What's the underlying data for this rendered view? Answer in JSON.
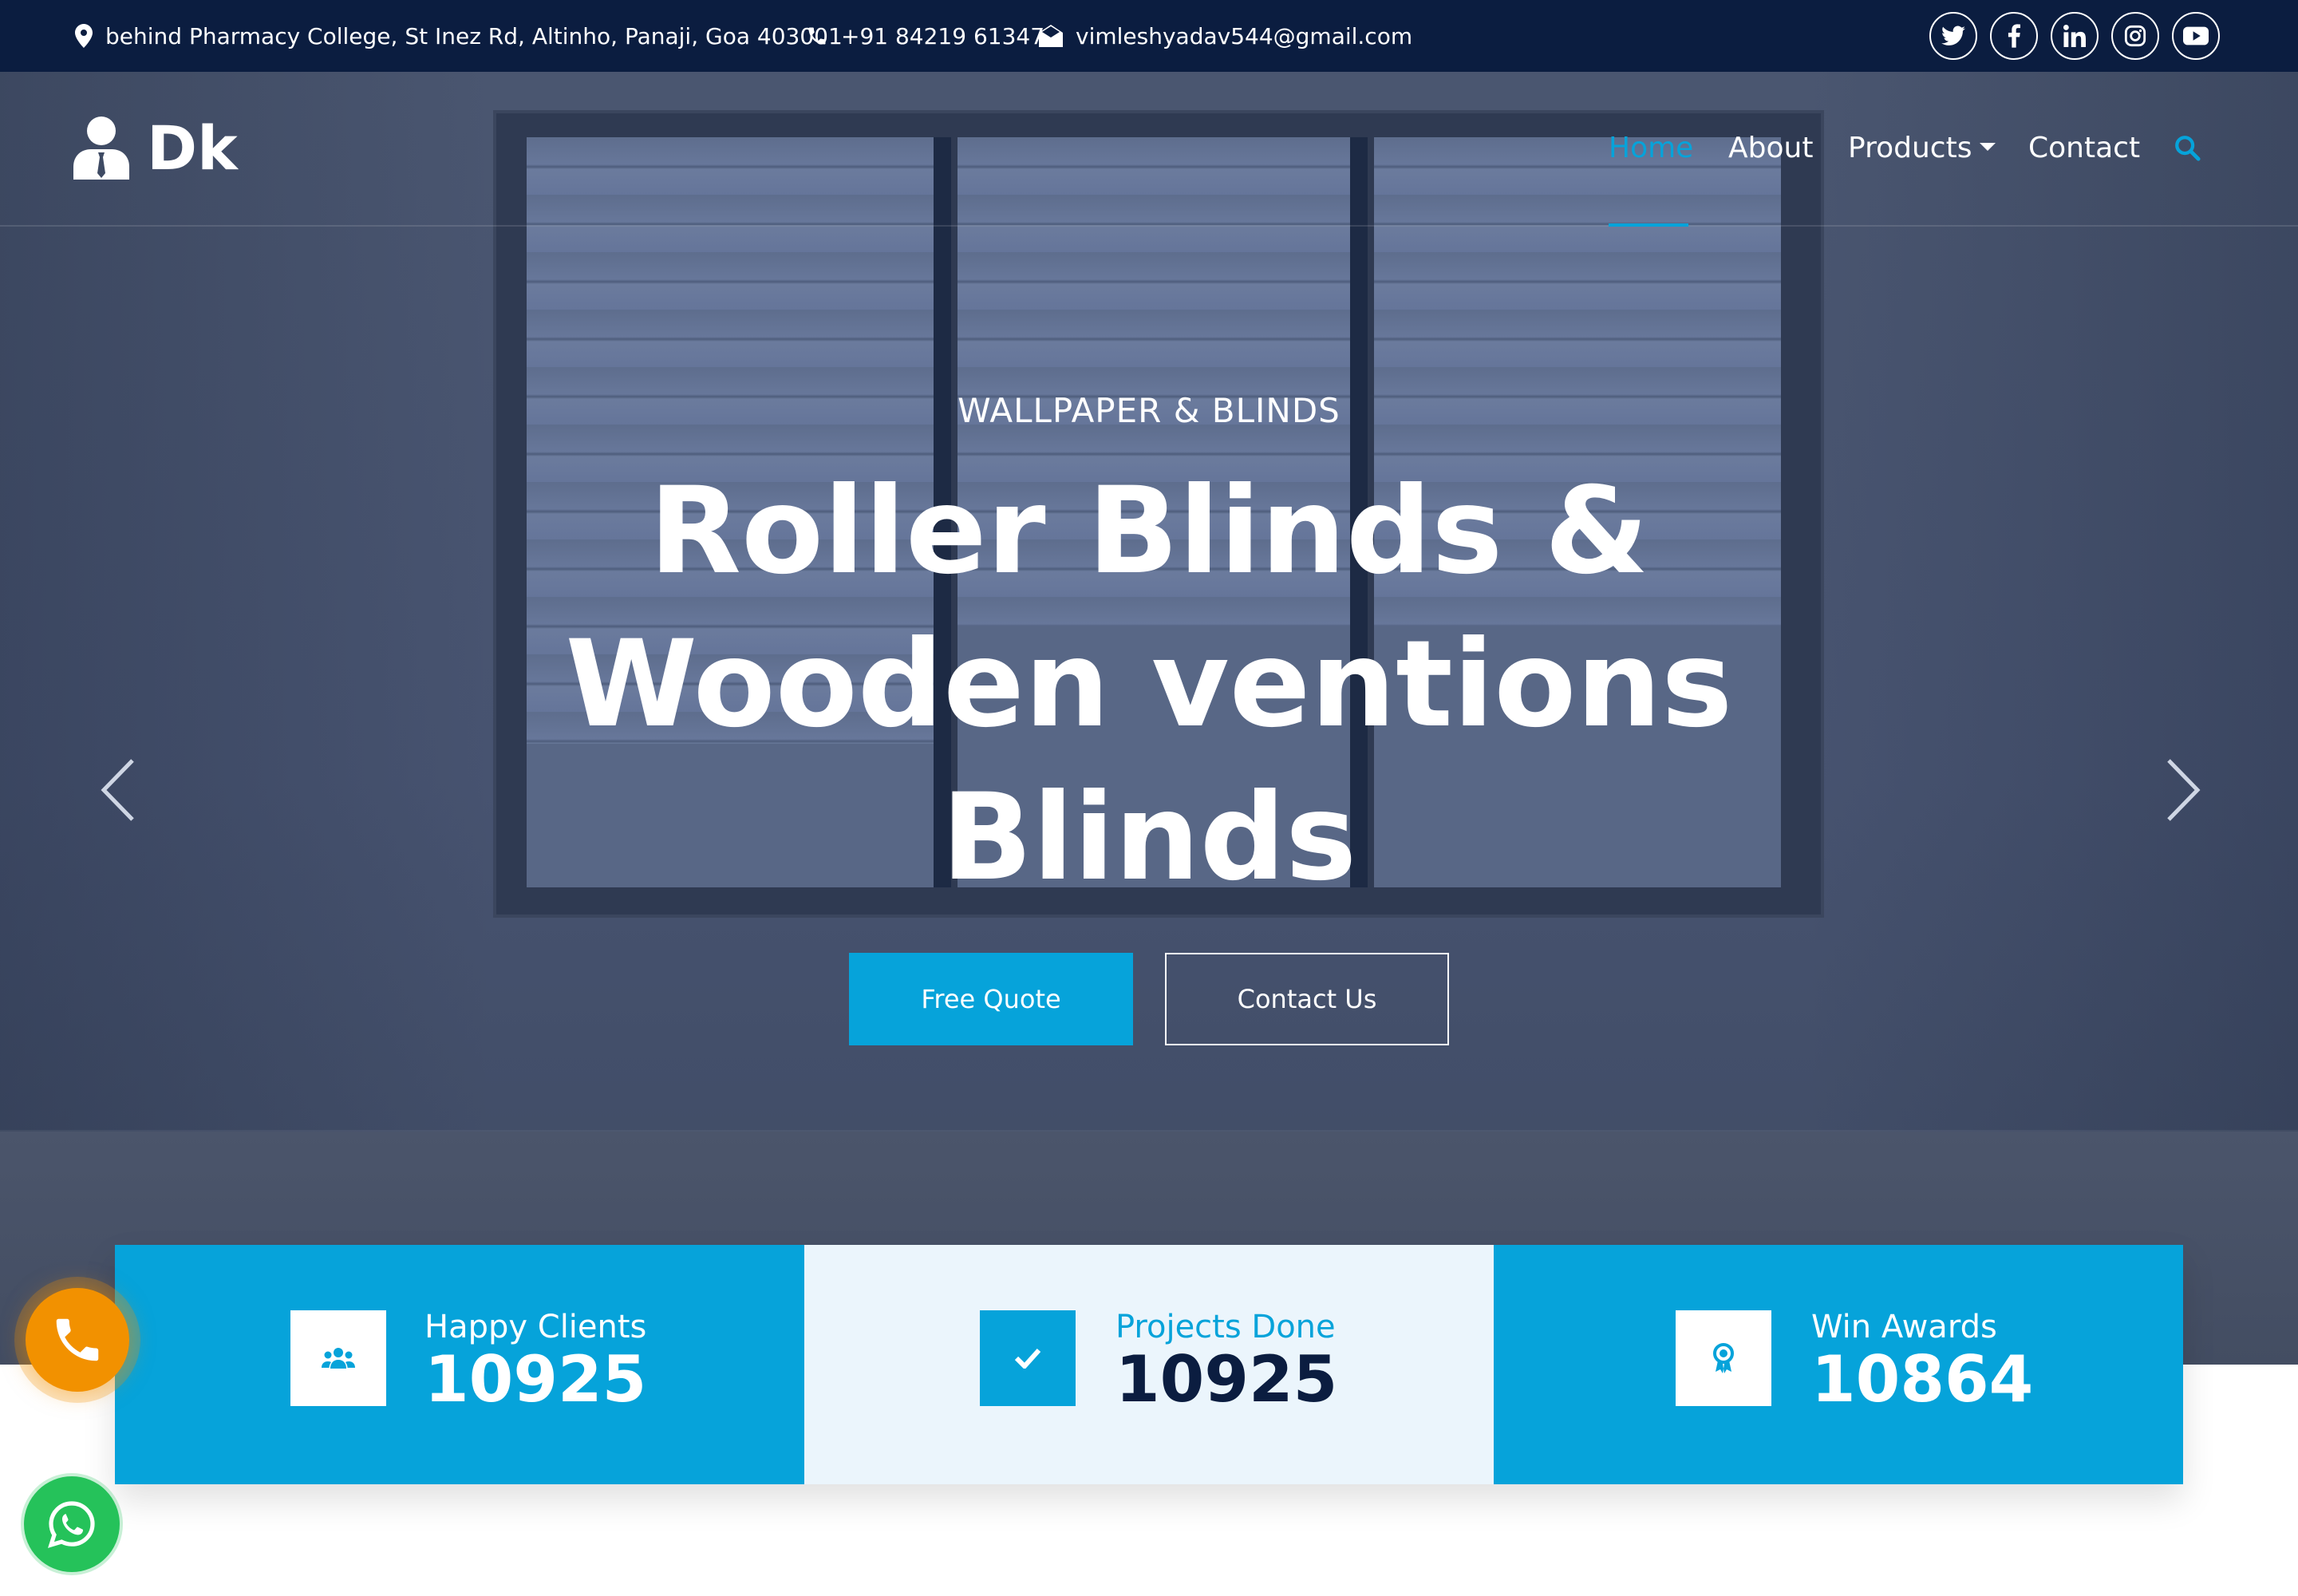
{
  "topbar": {
    "address": "behind Pharmacy College, St Inez Rd, Altinho, Panaji, Goa 403001",
    "phone": "+91 84219 61347",
    "email": "vimleshyadav544@gmail.com",
    "social": [
      "twitter-icon",
      "facebook-icon",
      "linkedin-icon",
      "instagram-icon",
      "youtube-icon"
    ]
  },
  "logo": {
    "text": "Dk"
  },
  "nav": {
    "home": "Home",
    "about": "About",
    "products": "Products",
    "contact": "Contact"
  },
  "hero": {
    "subtitle": "WALLPAPER & BLINDS",
    "title_line1": "Roller Blinds &",
    "title_line2": "Wooden ventions",
    "title_line3": "Blinds",
    "quote_button": "Free Quote",
    "contact_button": "Contact Us"
  },
  "stats": [
    {
      "label": "Happy Clients",
      "value": "10925",
      "icon": "users-icon"
    },
    {
      "label": "Projects Done",
      "value": "10925",
      "icon": "check-icon"
    },
    {
      "label": "Win Awards",
      "value": "10864",
      "icon": "award-icon"
    }
  ],
  "colors": {
    "accent": "#06a3da",
    "topbar": "#0b1d40",
    "dark_text": "#0b1d40",
    "call": "#f29100",
    "whatsapp": "#25c25a"
  }
}
